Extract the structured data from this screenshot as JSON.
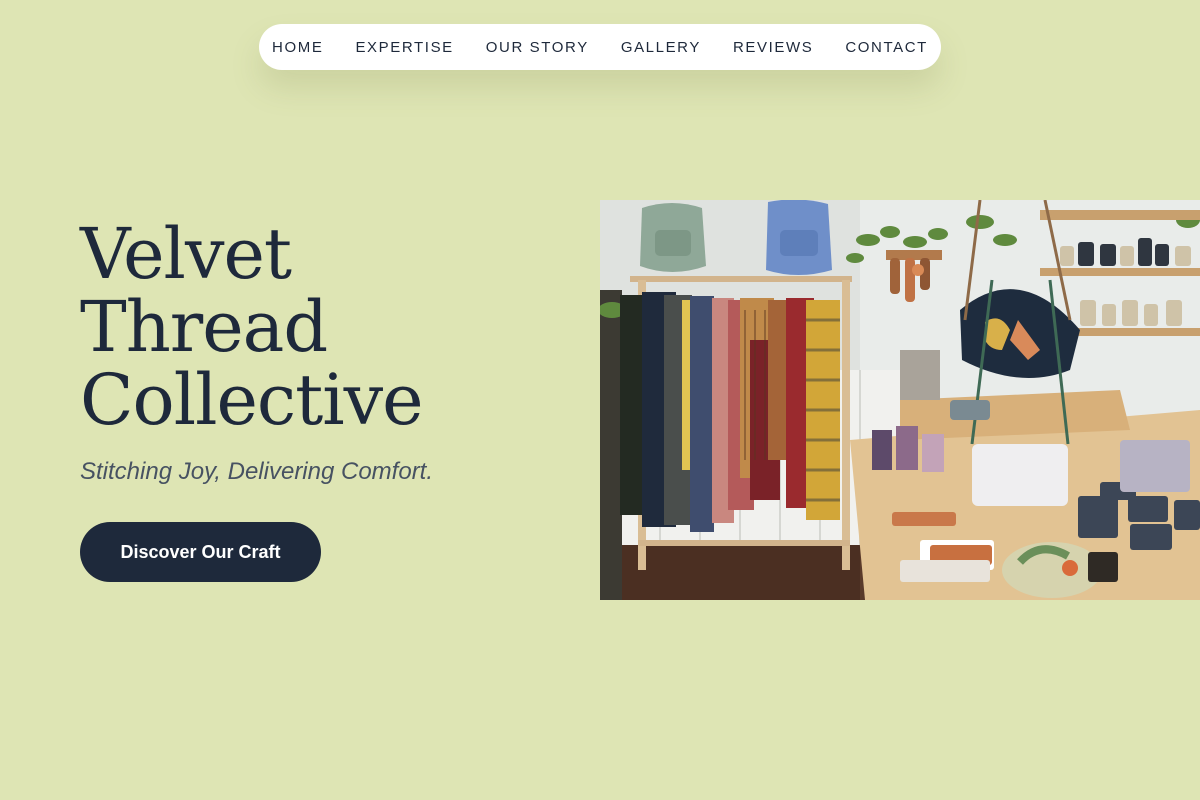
{
  "nav": {
    "items": [
      {
        "label": "HOME"
      },
      {
        "label": "EXPERTISE"
      },
      {
        "label": "OUR STORY"
      },
      {
        "label": "GALLERY"
      },
      {
        "label": "REVIEWS"
      },
      {
        "label": "CONTACT"
      }
    ]
  },
  "hero": {
    "title_lines": [
      "Velvet",
      "Thread",
      "Collective"
    ],
    "tagline": "Stitching Joy, Delivering Comfort.",
    "cta_label": "Discover Our Craft",
    "image_alt": "Boutique interior with clothing rack, backpacks, bags and shelves of ceramics"
  },
  "colors": {
    "background": "#dee5b4",
    "primary": "#1e293b",
    "nav_background": "#ffffff",
    "tagline": "#475262"
  }
}
